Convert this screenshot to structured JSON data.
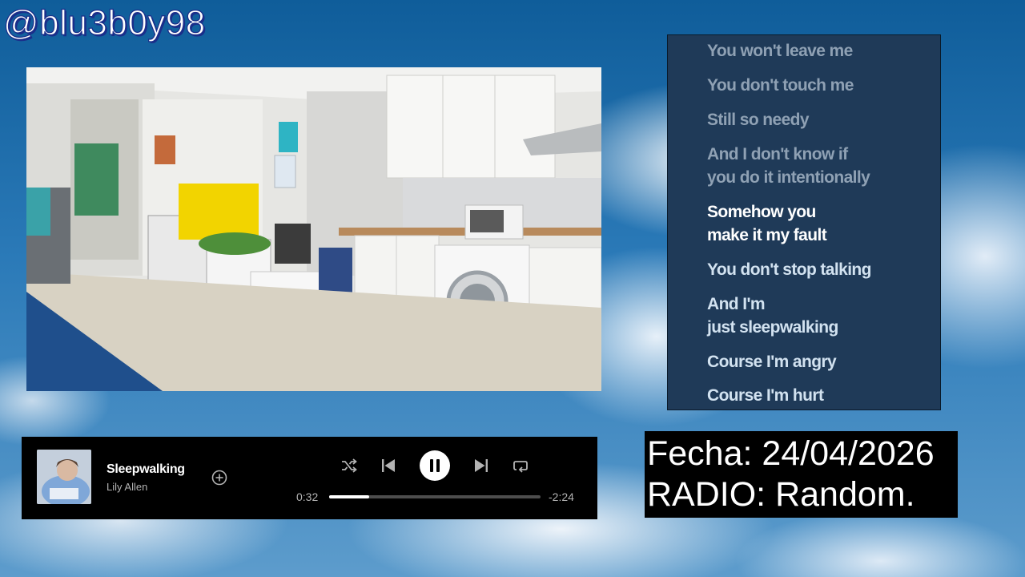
{
  "overlay": {
    "handle": "@blu3b0y98"
  },
  "lyrics": {
    "lines": [
      {
        "text": "You won't leave me",
        "state": "past"
      },
      {
        "text": "You don't touch me",
        "state": "past"
      },
      {
        "text": "Still so needy",
        "state": "past"
      },
      {
        "text": "And I don't know if\nyou do it intentionally",
        "state": "past"
      },
      {
        "text": "Somehow you\nmake it my fault",
        "state": "active"
      },
      {
        "text": "You don't stop talking",
        "state": "upcoming"
      },
      {
        "text": "And I'm\njust sleepwalking",
        "state": "upcoming"
      },
      {
        "text": "Course I'm angry",
        "state": "upcoming"
      },
      {
        "text": "Course I'm hurt",
        "state": "upcoming"
      }
    ]
  },
  "player": {
    "track_title": "Sleepwalking",
    "artist": "Lily Allen",
    "elapsed": "0:32",
    "remaining": "-2:24",
    "progress": 0.19,
    "state": "playing",
    "icons": [
      "add-icon",
      "shuffle-icon",
      "previous-icon",
      "pause-icon",
      "next-icon",
      "repeat-icon"
    ]
  },
  "info_box": {
    "date_line": "Fecha: 24/04/2026",
    "radio_line": "RADIO: Random."
  },
  "colors": {
    "lyrics_bg": "#1f3a58",
    "lyric_active": "#ffffff",
    "lyric_past": "#8fa1b4",
    "player_bg": "#000000",
    "progress_fill": "#ffffff"
  }
}
